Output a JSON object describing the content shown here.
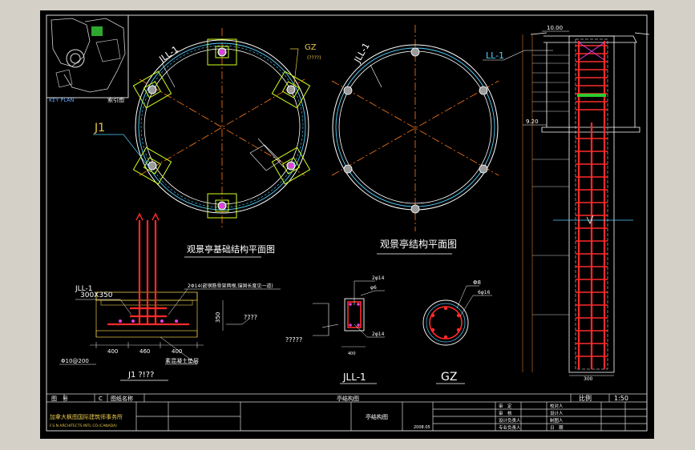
{
  "colors": {
    "background": "#000000",
    "frame": "#d8d8d8",
    "rebar": "#ff2a2a",
    "axis": "#ff7a1a",
    "ring": "#ffffff",
    "ring_inner": "#55d0ff",
    "column": "#d2ff1c",
    "label": "#ffffff",
    "leader": "#e8c84a",
    "dimension": "#d47a2f",
    "magenta": "#e040e0"
  },
  "key_plan": {
    "label": "KEY PLAN",
    "label_cn": "索引图"
  },
  "plan_foundation": {
    "title": "观景亭基础结构平面图",
    "label_jll": "JLL-1",
    "label_gz": "GZ",
    "label_gz_note": "(????)",
    "label_j1": "J1"
  },
  "plan_structure": {
    "title": "观景亭结构平面图",
    "label_jll": "JLL-1"
  },
  "column_elevation": {
    "label_ll": "LL-1",
    "dim_top": "10.00",
    "dim_mid": "9.20",
    "width": "300"
  },
  "foundation_section": {
    "label": "JLL-1",
    "size": "300X350",
    "note": "2Φ14(嵌钢筋骨架两根,锚固长度见一道)",
    "dim_height": "350",
    "dim_q": "????",
    "dims": [
      "400",
      "460",
      "400"
    ],
    "rebar_note": "Φ10@200",
    "base_note": "素混凝土垫层",
    "caption": "J1 ?!??"
  },
  "beam_section": {
    "label": "JLL-1",
    "rebar_top": "2φ14",
    "rebar_bottom": "2φ14",
    "stirrup": "φ6",
    "dim_q": "?????",
    "width": "400"
  },
  "column_section": {
    "label": "GZ",
    "stirrup": "Φ8",
    "rebar": "6φ16"
  },
  "title_block": {
    "fig_no_label": "图　号",
    "fig_no": "C",
    "fig_name_label": "图纸名称",
    "drawing_name": "亭结构图",
    "scale_label": "比例",
    "scale": "1:50",
    "company_cn": "加拿大枫图国际建筑师事务所",
    "company_en": "F.S.N ARCHITECTS INTL CO.(CANADA)",
    "project": "亭结构图",
    "roles": [
      "审　定",
      "审　核",
      "设计负责人",
      "专业负责人"
    ],
    "roles_right": [
      "校对人",
      "设计人",
      "制图人",
      "日　期"
    ],
    "date_code": "2008.05"
  }
}
